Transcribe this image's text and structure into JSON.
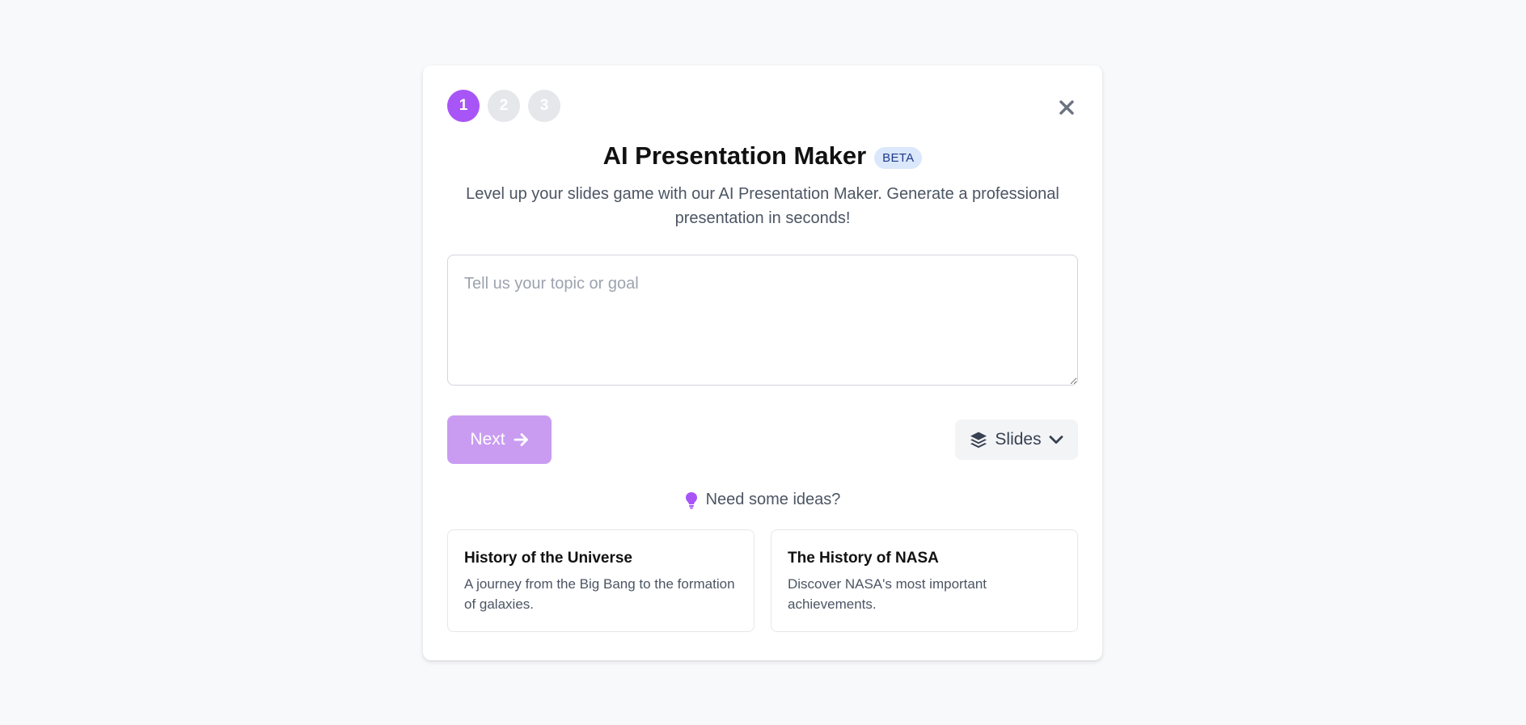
{
  "steps": [
    "1",
    "2",
    "3"
  ],
  "active_step": 1,
  "header": {
    "title": "AI Presentation Maker",
    "badge": "BETA",
    "subtitle": "Level up your slides game with our AI Presentation Maker. Generate a professional presentation in seconds!"
  },
  "topic_input": {
    "value": "",
    "placeholder": "Tell us your topic or goal"
  },
  "actions": {
    "next_label": "Next",
    "format_label": "Slides"
  },
  "ideas": {
    "label": "Need some ideas?",
    "cards": [
      {
        "title": "History of the Universe",
        "description": "A journey from the Big Bang to the formation of galaxies."
      },
      {
        "title": "The History of NASA",
        "description": "Discover NASA's most important achievements."
      }
    ]
  },
  "colors": {
    "accent": "#a855f7",
    "next_button": "#c99cf2",
    "inactive_step": "#e5e7eb",
    "badge_bg": "#dbe7fb",
    "badge_text": "#1e3a8a"
  },
  "icons": {
    "close": "close-icon",
    "next": "arrow-right-icon",
    "format": "layers-icon",
    "dropdown": "chevron-down-icon",
    "ideas": "lightbulb-icon"
  }
}
